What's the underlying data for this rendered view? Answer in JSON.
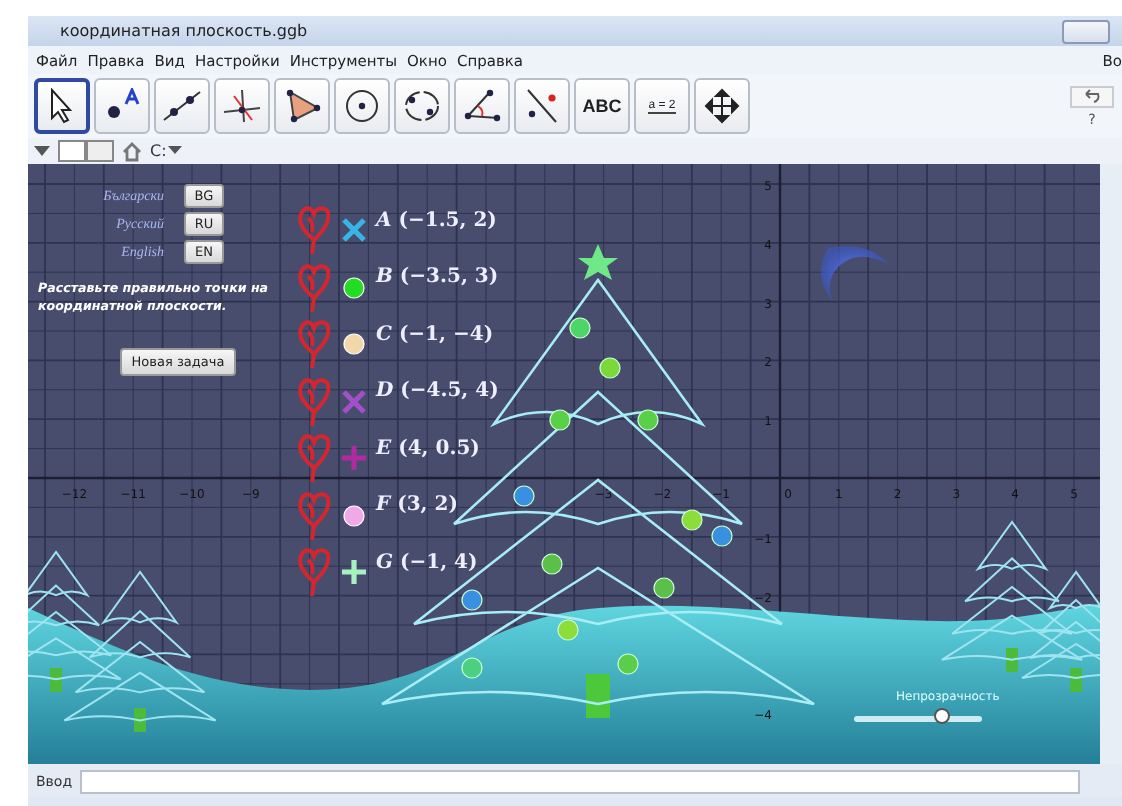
{
  "window": {
    "title": "координатная плоскость.ggb"
  },
  "menu": [
    "Файл",
    "Правка",
    "Вид",
    "Настройки",
    "Инструменты",
    "Окно",
    "Справка"
  ],
  "menu_right": "Во",
  "toolbar": [
    {
      "kind": "move",
      "selected": true
    },
    {
      "kind": "point",
      "selected": false
    },
    {
      "kind": "line",
      "selected": false
    },
    {
      "kind": "perpendicular",
      "selected": false
    },
    {
      "kind": "polygon",
      "selected": false
    },
    {
      "kind": "circle",
      "selected": false
    },
    {
      "kind": "conic",
      "selected": false
    },
    {
      "kind": "angle",
      "selected": false
    },
    {
      "kind": "reflect",
      "selected": false
    },
    {
      "kind": "text",
      "label": "ABC",
      "selected": false
    },
    {
      "kind": "slider",
      "label": "a = 2",
      "selected": false
    },
    {
      "kind": "move-view",
      "selected": false
    }
  ],
  "help": "?",
  "style_bar": {
    "drive": "C:"
  },
  "graphics": {
    "x_ticks": [
      "−12",
      "−11",
      "−10",
      "−9",
      "−3",
      "−2",
      "−1",
      "0",
      "1",
      "2",
      "3",
      "4",
      "5"
    ],
    "y_ticks": [
      "5",
      "4",
      "3",
      "2",
      "1",
      "−1",
      "−2",
      "−4"
    ],
    "languages": [
      {
        "name": "Български",
        "code": "BG"
      },
      {
        "name": "Русский",
        "code": "RU"
      },
      {
        "name": "English",
        "code": "EN"
      }
    ],
    "task": "Расставьте правильно точки на координатной плоскости.",
    "new_task_button": "Новая задача",
    "points": [
      {
        "name": "A",
        "coords": "(−1.5, 2)",
        "kind": "cross",
        "color": "#38b4e6"
      },
      {
        "name": "B",
        "coords": "(−3.5, 3)",
        "kind": "dot",
        "color": "#22dd22"
      },
      {
        "name": "C",
        "coords": "(−1, −4)",
        "kind": "dot",
        "color": "#f0d8a8"
      },
      {
        "name": "D",
        "coords": "(−4.5, 4)",
        "kind": "cross",
        "color": "#a050c8"
      },
      {
        "name": "E",
        "coords": "(4, 0.5)",
        "kind": "plus",
        "color": "#b02aa0"
      },
      {
        "name": "F",
        "coords": "(3, 2)",
        "kind": "dot",
        "color": "#f0a8e8"
      },
      {
        "name": "G",
        "coords": "(−1, 4)",
        "kind": "plus",
        "color": "#a8f0c0"
      }
    ],
    "slider": {
      "label": "Непрозрачность",
      "level": 0.69
    }
  },
  "input_bar": {
    "label": "Ввод"
  }
}
